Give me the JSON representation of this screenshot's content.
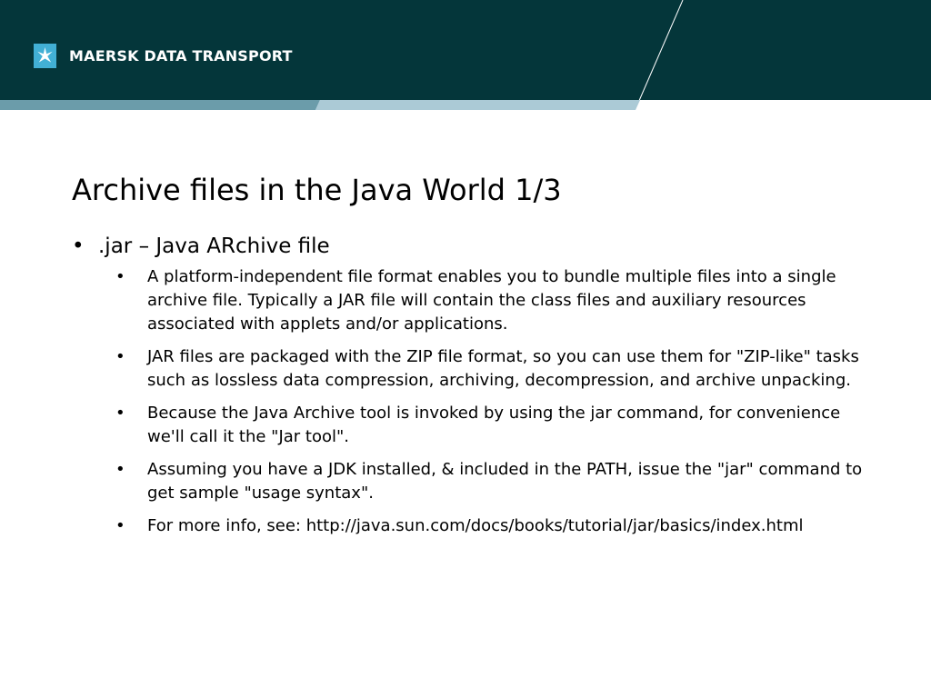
{
  "header": {
    "brand": "MAERSK DATA TRANSPORT",
    "colors": {
      "background": "#04363a",
      "band_left": "#6b9caa",
      "band_right": "#abcad6",
      "star_box": "#42b0d5"
    }
  },
  "slide": {
    "title": "Archive files in the Java World 1/3",
    "main_bullet": ".jar – Java ARchive file",
    "sub_bullets": [
      "A platform-independent file format enables you to bundle multiple files into a single archive file. Typically a JAR file will contain the class files and auxiliary resources associated with applets and/or applications.",
      "JAR files are packaged with the ZIP file format, so you can use them for \"ZIP-like\" tasks such as lossless data compression, archiving, decompression, and archive unpacking.",
      "Because the Java Archive tool is invoked by using the jar command, for convenience we'll call it the \"Jar tool\".",
      "Assuming you have a JDK installed, & included in the PATH, issue the \"jar\" command to get sample \"usage syntax\".",
      "For more info, see: http://java.sun.com/docs/books/tutorial/jar/basics/index.html"
    ]
  }
}
